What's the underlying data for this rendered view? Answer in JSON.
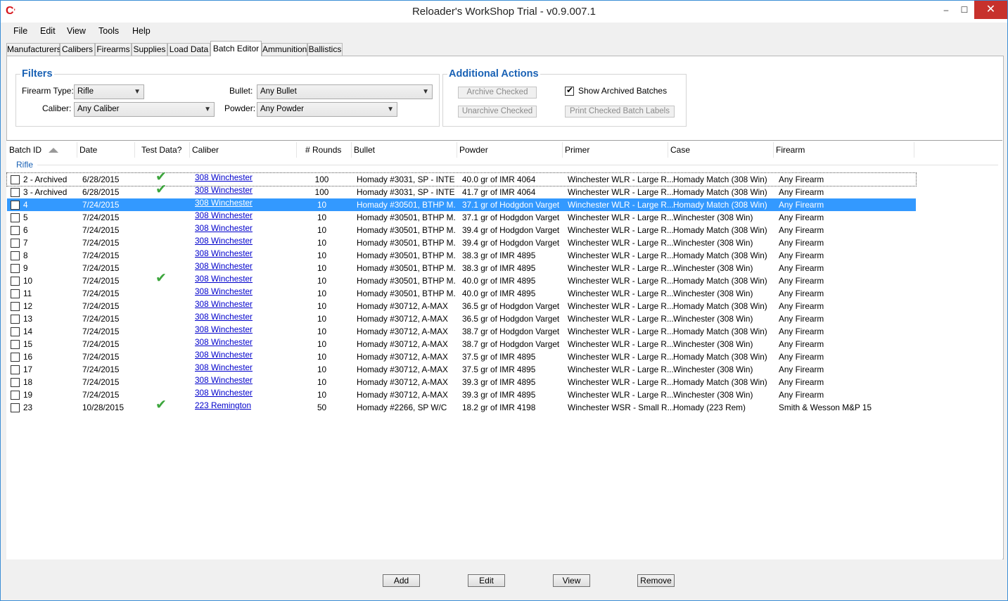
{
  "window": {
    "title": "Reloader's WorkShop Trial - v0.9.007.1",
    "icon": "app-logo-icon",
    "minimize": "‒",
    "maximize": "☐",
    "close": "✕"
  },
  "menu": [
    "File",
    "Edit",
    "View",
    "Tools",
    "Help"
  ],
  "tabs": [
    "Manufacturers",
    "Calibers",
    "Firearms",
    "Supplies",
    "Load Data",
    "Batch Editor",
    "Ammunition",
    "Ballistics"
  ],
  "active_tab": "Batch Editor",
  "filters": {
    "title": "Filters",
    "firearm_type_label": "Firearm Type:",
    "firearm_type_value": "Rifle",
    "caliber_label": "Caliber:",
    "caliber_value": "Any Caliber",
    "bullet_label": "Bullet:",
    "bullet_value": "Any Bullet",
    "powder_label": "Powder:",
    "powder_value": "Any Powder"
  },
  "actions": {
    "title": "Additional Actions",
    "archive_checked": "Archive Checked",
    "unarchive_checked": "Unarchive Checked",
    "show_archived_label": "Show Archived Batches",
    "show_archived_checked": true,
    "print_labels": "Print Checked Batch Labels"
  },
  "columns": [
    "Batch ID",
    "Date",
    "Test Data?",
    "Caliber",
    "# Rounds",
    "Bullet",
    "Powder",
    "Primer",
    "Case",
    "Firearm"
  ],
  "group_label": "Rifle",
  "rows": [
    {
      "id": "2 - Archived",
      "date": "6/28/2015",
      "test": true,
      "caliber": "308 Winchester",
      "rounds": "100",
      "bullet": "Homady #3031, SP - INTE...",
      "powder": "40.0 gr of IMR 4064",
      "primer": "Winchester WLR - Large R...",
      "case": "Homady Match (308 Win)",
      "firearm": "Any Firearm"
    },
    {
      "id": "3 - Archived",
      "date": "6/28/2015",
      "test": true,
      "caliber": "308 Winchester",
      "rounds": "100",
      "bullet": "Homady #3031, SP - INTE...",
      "powder": "41.7 gr of IMR 4064",
      "primer": "Winchester WLR - Large R...",
      "case": "Homady Match (308 Win)",
      "firearm": "Any Firearm"
    },
    {
      "id": "4",
      "date": "7/24/2015",
      "test": false,
      "caliber": "308 Winchester",
      "rounds": "10",
      "bullet": "Homady #30501, BTHP M...",
      "powder": "37.1 gr of Hodgdon Varget",
      "primer": "Winchester WLR - Large R...",
      "case": "Homady Match (308 Win)",
      "firearm": "Any Firearm"
    },
    {
      "id": "5",
      "date": "7/24/2015",
      "test": false,
      "caliber": "308 Winchester",
      "rounds": "10",
      "bullet": "Homady #30501, BTHP M...",
      "powder": "37.1 gr of Hodgdon Varget",
      "primer": "Winchester WLR - Large R...",
      "case": "Winchester (308 Win)",
      "firearm": "Any Firearm"
    },
    {
      "id": "6",
      "date": "7/24/2015",
      "test": false,
      "caliber": "308 Winchester",
      "rounds": "10",
      "bullet": "Homady #30501, BTHP M...",
      "powder": "39.4 gr of Hodgdon Varget",
      "primer": "Winchester WLR - Large R...",
      "case": "Homady Match (308 Win)",
      "firearm": "Any Firearm"
    },
    {
      "id": "7",
      "date": "7/24/2015",
      "test": false,
      "caliber": "308 Winchester",
      "rounds": "10",
      "bullet": "Homady #30501, BTHP M...",
      "powder": "39.4 gr of Hodgdon Varget",
      "primer": "Winchester WLR - Large R...",
      "case": "Winchester (308 Win)",
      "firearm": "Any Firearm"
    },
    {
      "id": "8",
      "date": "7/24/2015",
      "test": false,
      "caliber": "308 Winchester",
      "rounds": "10",
      "bullet": "Homady #30501, BTHP M...",
      "powder": "38.3 gr of IMR 4895",
      "primer": "Winchester WLR - Large R...",
      "case": "Homady Match (308 Win)",
      "firearm": "Any Firearm"
    },
    {
      "id": "9",
      "date": "7/24/2015",
      "test": false,
      "caliber": "308 Winchester",
      "rounds": "10",
      "bullet": "Homady #30501, BTHP M...",
      "powder": "38.3 gr of IMR 4895",
      "primer": "Winchester WLR - Large R...",
      "case": "Winchester (308 Win)",
      "firearm": "Any Firearm"
    },
    {
      "id": "10",
      "date": "7/24/2015",
      "test": true,
      "caliber": "308 Winchester",
      "rounds": "10",
      "bullet": "Homady #30501, BTHP M...",
      "powder": "40.0 gr of IMR 4895",
      "primer": "Winchester WLR - Large R...",
      "case": "Homady Match (308 Win)",
      "firearm": "Any Firearm"
    },
    {
      "id": "11",
      "date": "7/24/2015",
      "test": false,
      "caliber": "308 Winchester",
      "rounds": "10",
      "bullet": "Homady #30501, BTHP M...",
      "powder": "40.0 gr of IMR 4895",
      "primer": "Winchester WLR - Large R...",
      "case": "Winchester (308 Win)",
      "firearm": "Any Firearm"
    },
    {
      "id": "12",
      "date": "7/24/2015",
      "test": false,
      "caliber": "308 Winchester",
      "rounds": "10",
      "bullet": "Homady #30712, A-MAX",
      "powder": "36.5 gr of Hodgdon Varget",
      "primer": "Winchester WLR - Large R...",
      "case": "Homady Match (308 Win)",
      "firearm": "Any Firearm"
    },
    {
      "id": "13",
      "date": "7/24/2015",
      "test": false,
      "caliber": "308 Winchester",
      "rounds": "10",
      "bullet": "Homady #30712, A-MAX",
      "powder": "36.5 gr of Hodgdon Varget",
      "primer": "Winchester WLR - Large R...",
      "case": "Winchester (308 Win)",
      "firearm": "Any Firearm"
    },
    {
      "id": "14",
      "date": "7/24/2015",
      "test": false,
      "caliber": "308 Winchester",
      "rounds": "10",
      "bullet": "Homady #30712, A-MAX",
      "powder": "38.7 gr of Hodgdon Varget",
      "primer": "Winchester WLR - Large R...",
      "case": "Homady Match (308 Win)",
      "firearm": "Any Firearm"
    },
    {
      "id": "15",
      "date": "7/24/2015",
      "test": false,
      "caliber": "308 Winchester",
      "rounds": "10",
      "bullet": "Homady #30712, A-MAX",
      "powder": "38.7 gr of Hodgdon Varget",
      "primer": "Winchester WLR - Large R...",
      "case": "Winchester (308 Win)",
      "firearm": "Any Firearm"
    },
    {
      "id": "16",
      "date": "7/24/2015",
      "test": false,
      "caliber": "308 Winchester",
      "rounds": "10",
      "bullet": "Homady #30712, A-MAX",
      "powder": "37.5 gr of IMR 4895",
      "primer": "Winchester WLR - Large R...",
      "case": "Homady Match (308 Win)",
      "firearm": "Any Firearm"
    },
    {
      "id": "17",
      "date": "7/24/2015",
      "test": false,
      "caliber": "308 Winchester",
      "rounds": "10",
      "bullet": "Homady #30712, A-MAX",
      "powder": "37.5 gr of IMR 4895",
      "primer": "Winchester WLR - Large R...",
      "case": "Winchester (308 Win)",
      "firearm": "Any Firearm"
    },
    {
      "id": "18",
      "date": "7/24/2015",
      "test": false,
      "caliber": "308 Winchester",
      "rounds": "10",
      "bullet": "Homady #30712, A-MAX",
      "powder": "39.3 gr of IMR 4895",
      "primer": "Winchester WLR - Large R...",
      "case": "Homady Match (308 Win)",
      "firearm": "Any Firearm"
    },
    {
      "id": "19",
      "date": "7/24/2015",
      "test": false,
      "caliber": "308 Winchester",
      "rounds": "10",
      "bullet": "Homady #30712, A-MAX",
      "powder": "39.3 gr of IMR 4895",
      "primer": "Winchester WLR - Large R...",
      "case": "Winchester (308 Win)",
      "firearm": "Any Firearm"
    },
    {
      "id": "23",
      "date": "10/28/2015",
      "test": true,
      "caliber": "223 Remington",
      "rounds": "50",
      "bullet": "Homady #2266, SP W/C",
      "powder": "18.2 gr of IMR 4198",
      "primer": "Winchester WSR - Small R...",
      "case": "Homady (223 Rem)",
      "firearm": "Smith & Wesson M&P 15"
    }
  ],
  "selected_row_id": "4",
  "buttons": {
    "add": "Add",
    "edit": "Edit",
    "view": "View",
    "remove": "Remove"
  },
  "colors": {
    "accent": "#1a62b5",
    "selection": "#3399ff",
    "check": "#3da63d",
    "link": "#0000cc",
    "close": "#c7312c"
  }
}
